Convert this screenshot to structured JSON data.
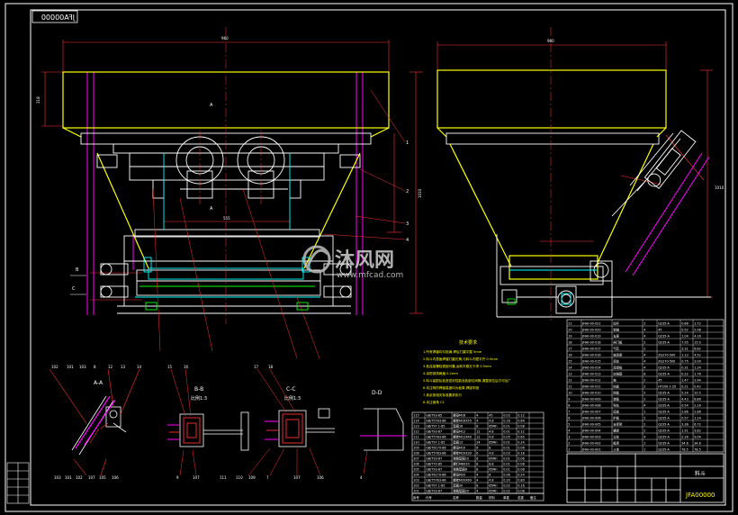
{
  "drawing": {
    "drawing_number": "JFA00000",
    "title_block_name": "JFA00000",
    "title_block_label": "料斗"
  },
  "views": {
    "section_aa": "A-A",
    "section_bb": "B-B",
    "section_bb_scale": "比例1:3",
    "section_cc": "C-C",
    "section_cc_scale": "比例1:3",
    "view_dd": "D-D"
  },
  "tech_requirements": {
    "heading": "技术要求",
    "lines": [
      "1.所有焊缝均匀饱满,焊后打磨平整 5mm",
      "2.料斗内表面焊缝打磨光滑,与料斗内壁平齐 0.5mm",
      "3.各连接螺栓紧固可靠,运转平稳无卡滞 0.5mm",
      "4.涂防锈漆两遍 0.2mm",
      "5.料斗装配后检查密封性能及各部位间隙,调整到位后方可出厂",
      "6.未注明的焊缝高度均为板厚,焊接牢固",
      "7.其余按相关标准要求执行",
      "8.未注倒角 C1"
    ]
  },
  "balloons": [
    "1",
    "2",
    "3",
    "4",
    "5",
    "6",
    "7",
    "8",
    "9",
    "10",
    "11",
    "12",
    "13",
    "14",
    "15",
    "16",
    "17",
    "18",
    "19",
    "20"
  ],
  "left_bom": {
    "columns": [
      "序号",
      "代号",
      "名称",
      "数量",
      "材料",
      "单重",
      "总重",
      "备注"
    ],
    "rows": [
      [
        "115",
        "GB/T93-85",
        "螺母M16",
        "4",
        "45",
        "0.03",
        "0.12",
        ""
      ],
      [
        "114",
        "GB/T5783-86",
        "螺栓M16X55",
        "4",
        "4.8",
        "0.16",
        "0.64",
        ""
      ],
      [
        "113",
        "GB/T97.1-85",
        "垫圈16",
        "8",
        "65Mn",
        "0.01",
        "0.08",
        ""
      ],
      [
        "112",
        "GB/T93-87",
        "螺母M12",
        "12",
        "4.8",
        "0.01",
        "0.12",
        ""
      ],
      [
        "111",
        "GB/T5783-86",
        "螺栓M12X40",
        "12",
        "4.8",
        "0.05",
        "0.60",
        ""
      ],
      [
        "110",
        "GB/T97.1-85",
        "垫圈12",
        "24",
        "65Mn",
        "0.01",
        "0.24",
        ""
      ],
      [
        "109",
        "GB/T6170-86",
        "螺母M10",
        "6",
        "8",
        "0.01",
        "0.06",
        ""
      ],
      [
        "108",
        "GB/T5783-86",
        "螺栓M10X30",
        "6",
        "4.8",
        "0.03",
        "0.18",
        ""
      ],
      [
        "107",
        "GB/T93-87",
        "弹簧垫圈10",
        "6",
        "65Mn",
        "0.01",
        "0.06",
        ""
      ],
      [
        "106",
        "GB/T70-85",
        "螺钉M8X20",
        "8",
        "8.8",
        "0.01",
        "0.08",
        ""
      ],
      [
        "105",
        "GB/T93-87",
        "弹簧垫圈8",
        "8",
        "65Mn",
        "0.01",
        "0.08",
        ""
      ],
      [
        "104",
        "GB/T6170-86",
        "螺母M20",
        "4",
        "8",
        "0.06",
        "0.24",
        ""
      ],
      [
        "103",
        "GB/T5783-86",
        "螺栓M20X60",
        "4",
        "4.8",
        "0.20",
        "0.80",
        ""
      ],
      [
        "102",
        "GB/T97.1-85",
        "垫圈20",
        "8",
        "65Mn",
        "0.02",
        "0.16",
        ""
      ],
      [
        "101",
        "GB/T93-87",
        "弹簧垫圈20",
        "4",
        "65Mn",
        "0.02",
        "0.08",
        ""
      ]
    ]
  },
  "right_bom": {
    "rows": [
      [
        "21",
        "JFA0-00-021",
        "拉杆",
        "2",
        "Q235-A",
        "0.86",
        "1.72",
        ""
      ],
      [
        "20",
        "JFA0-00-020",
        "销轴",
        "4",
        "45",
        "0.52",
        "2.08",
        ""
      ],
      [
        "19",
        "JFA0-00-019",
        "支座",
        "4",
        "Q235-A",
        "1.04",
        "4.16",
        ""
      ],
      [
        "18",
        "JFA0-00-018",
        "闸门板",
        "2",
        "Q235-A",
        "7.95",
        "15.9",
        ""
      ],
      [
        "17",
        "JFA0-00-017",
        "气缸",
        "2",
        "",
        "3.31",
        "6.62",
        ""
      ],
      [
        "16",
        "JFA0-00-016",
        "轴承座",
        "4",
        "ZG270-500",
        "1.13",
        "4.52",
        ""
      ],
      [
        "15",
        "JFA0-00-015",
        "滚轮",
        "4",
        "ZG270-500",
        "0.75",
        "3.00",
        ""
      ],
      [
        "14",
        "JFA0-00-014",
        "连接板",
        "4",
        "Q235-A",
        "0.31",
        "1.24",
        ""
      ],
      [
        "13",
        "JFA0-00-013",
        "加强筋",
        "8",
        "Q235-A",
        "0.22",
        "1.76",
        ""
      ],
      [
        "12",
        "JFA0-00-012",
        "轴",
        "2",
        "45",
        "1.47",
        "2.94",
        ""
      ],
      [
        "11",
        "JFA0-00-011",
        "挡板",
        "2",
        "HT200-1-25",
        "0.21",
        "0.42",
        ""
      ],
      [
        "10",
        "JFA0-00-010",
        "侧板",
        "2",
        "Q235-A",
        "5.24",
        "10.5",
        ""
      ],
      [
        "9",
        "JFA0-00-009",
        "端板",
        "2",
        "Q235-A",
        "4.43",
        "8.86",
        ""
      ],
      [
        "8",
        "JFA0-00-008",
        "导轨",
        "4",
        "Q235-A",
        "0.54",
        "2.16",
        ""
      ],
      [
        "7",
        "JFA0-00-007",
        "底板",
        "1",
        "Q235-A",
        "2.86",
        "2.86",
        ""
      ],
      [
        "6",
        "JFA0-00-006",
        "护板",
        "2",
        "Q235-A",
        "0.57",
        "1.14",
        ""
      ],
      [
        "5",
        "JFA0-00-005",
        "支撑架",
        "2",
        "Q235-A",
        "3.36",
        "6.72",
        ""
      ],
      [
        "4",
        "JFA0-00-004",
        "横梁",
        "2",
        "Q235-A",
        "1.91",
        "3.82",
        ""
      ],
      [
        "3",
        "JFA0-00-003",
        "立柱",
        "4",
        "Q235-A",
        "2.26",
        "9.04",
        ""
      ],
      [
        "2",
        "JFA0-00-002",
        "框架",
        "1",
        "Q235-A",
        "34.6",
        "34.6",
        ""
      ],
      [
        "1",
        "JFA0-00-001",
        "斗体",
        "1",
        "Q235-A",
        "78.5",
        "78.5",
        ""
      ]
    ]
  },
  "watermark": {
    "brand": "沐风网",
    "url": "www.mfcad.com"
  }
}
